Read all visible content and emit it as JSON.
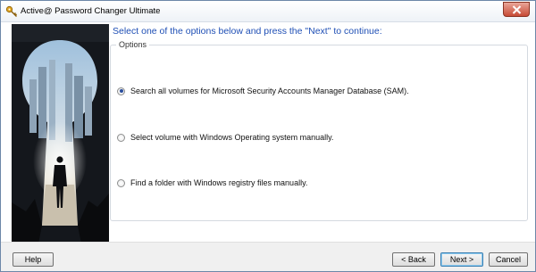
{
  "window": {
    "title": "Active@ Password Changer Ultimate"
  },
  "main": {
    "instruction": "Select one of the options below and press the \"Next\" to continue:",
    "group_label": "Options",
    "options": [
      {
        "label": "Search all volumes for Microsoft Security Accounts Manager Database (SAM).",
        "selected": true
      },
      {
        "label": "Select volume with Windows Operating system manually.",
        "selected": false
      },
      {
        "label": "Find a folder with Windows registry files manually.",
        "selected": false
      }
    ]
  },
  "footer": {
    "help_label": "Help",
    "back_label": "< Back",
    "next_label": "Next >",
    "cancel_label": "Cancel"
  },
  "colors": {
    "instruction_text": "#1f4fb5",
    "close_button": "#c74a35"
  },
  "icons": [
    "key-app-icon",
    "close-icon"
  ]
}
